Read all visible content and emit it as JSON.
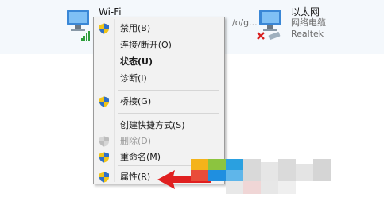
{
  "adapters": {
    "wifi": {
      "name": "Wi-Fi",
      "line2": "",
      "line3": "/o/g...",
      "icon": "network-computer-icon",
      "status_icon": "signal-bars-icon"
    },
    "ethernet": {
      "name": "以太网",
      "line2": "网络电缆",
      "line3": "Realtek",
      "icon": "network-computer-icon",
      "status_icon": "disconnected-x-icon"
    }
  },
  "context_menu": {
    "items": [
      {
        "label": "禁用(B)",
        "shield": true,
        "bold": false,
        "disabled": false
      },
      {
        "label": "连接/断开(O)",
        "shield": false,
        "bold": false,
        "disabled": false
      },
      {
        "label": "状态(U)",
        "shield": false,
        "bold": true,
        "disabled": false
      },
      {
        "label": "诊断(I)",
        "shield": false,
        "bold": false,
        "disabled": false
      },
      {
        "label": "桥接(G)",
        "shield": true,
        "bold": false,
        "disabled": false
      },
      {
        "label": "创建快捷方式(S)",
        "shield": false,
        "bold": false,
        "disabled": false
      },
      {
        "label": "删除(D)",
        "shield": true,
        "bold": false,
        "disabled": true
      },
      {
        "label": "重命名(M)",
        "shield": true,
        "bold": false,
        "disabled": false
      },
      {
        "label": "属性(R)",
        "shield": true,
        "bold": false,
        "disabled": false
      }
    ]
  },
  "colors": {
    "menu_bg": "#f2f2f2",
    "shield_blue": "#2d6fc9",
    "shield_yellow": "#f0c419",
    "arrow_red": "#e02020",
    "disconnected_red": "#d81e1e"
  },
  "icons": [
    "uac-shield-icon",
    "red-arrow-icon",
    "network-computer-icon",
    "signal-bars-icon",
    "disconnected-x-icon"
  ]
}
